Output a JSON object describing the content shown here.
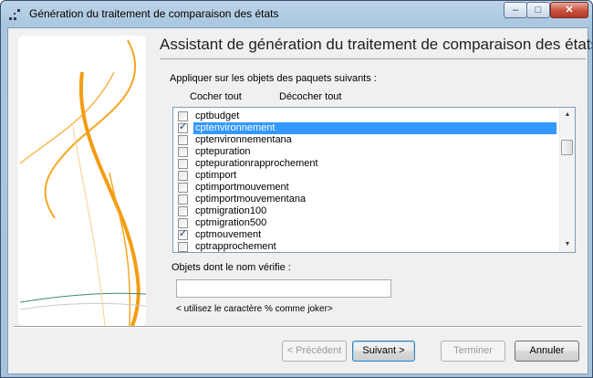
{
  "window": {
    "title": "Génération du traitement de comparaison des états",
    "controls": {
      "minimize": "–",
      "maximize": "□",
      "close": "✕"
    }
  },
  "header": {
    "title": "Assistant de génération du traitement de comparaison des états"
  },
  "packages": {
    "instruction": "Appliquer sur les objets des paquets suivants :",
    "check_all": "Cocher tout",
    "uncheck_all": "Décocher tout",
    "items": [
      {
        "label": "cptbudget",
        "checked": false,
        "selected": false
      },
      {
        "label": "cptenvironnement",
        "checked": true,
        "selected": true
      },
      {
        "label": "cptenvironnementana",
        "checked": false,
        "selected": false
      },
      {
        "label": "cptepuration",
        "checked": false,
        "selected": false
      },
      {
        "label": "cptepurationrapprochement",
        "checked": false,
        "selected": false
      },
      {
        "label": "cptimport",
        "checked": false,
        "selected": false
      },
      {
        "label": "cptimportmouvement",
        "checked": false,
        "selected": false
      },
      {
        "label": "cptimportmouvementana",
        "checked": false,
        "selected": false
      },
      {
        "label": "cptmigration100",
        "checked": false,
        "selected": false
      },
      {
        "label": "cptmigration500",
        "checked": false,
        "selected": false
      },
      {
        "label": "cptmouvement",
        "checked": true,
        "selected": false
      },
      {
        "label": "cptrapprochement",
        "checked": false,
        "selected": false
      }
    ]
  },
  "filter": {
    "label": "Objets dont le nom vérifie :",
    "value": "",
    "hint": "< utilisez le caractère % comme joker>"
  },
  "buttons": {
    "previous": "< Précédent",
    "next": "Suivant >",
    "finish": "Terminer",
    "cancel": "Annuler"
  },
  "colors": {
    "selection": "#3399ff",
    "accent_orange": "#f5a623"
  }
}
